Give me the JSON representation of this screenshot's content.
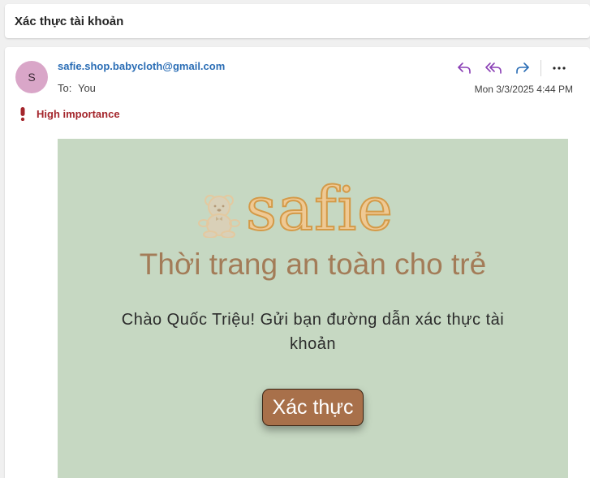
{
  "subject": "Xác thực tài khoản",
  "message": {
    "avatar_initial": "S",
    "sender": "safie.shop.babycloth@gmail.com",
    "to_label": "To:",
    "to_value": "You",
    "timestamp": "Mon 3/3/2025 4:44 PM",
    "importance": "High importance",
    "actions": [
      {
        "name": "reply-icon"
      },
      {
        "name": "reply-all-icon"
      },
      {
        "name": "forward-icon"
      },
      {
        "name": "more-options-icon"
      }
    ]
  },
  "email": {
    "brand": "safie",
    "tagline": "Thời trang an toàn cho trẻ",
    "greeting": "Chào Quốc Triệu! Gửi bạn đường dẫn xác thực tài khoản",
    "button_label": "Xác thực",
    "colors": {
      "background": "#c6d8c2",
      "brand": "#d49a48",
      "tagline": "#a37c58",
      "button": "#a8704a"
    }
  },
  "colors": {
    "link": "#2a6db5",
    "importance": "#a4262c",
    "action_icon": "#8a3fb5",
    "forward_icon": "#2a6db5"
  }
}
